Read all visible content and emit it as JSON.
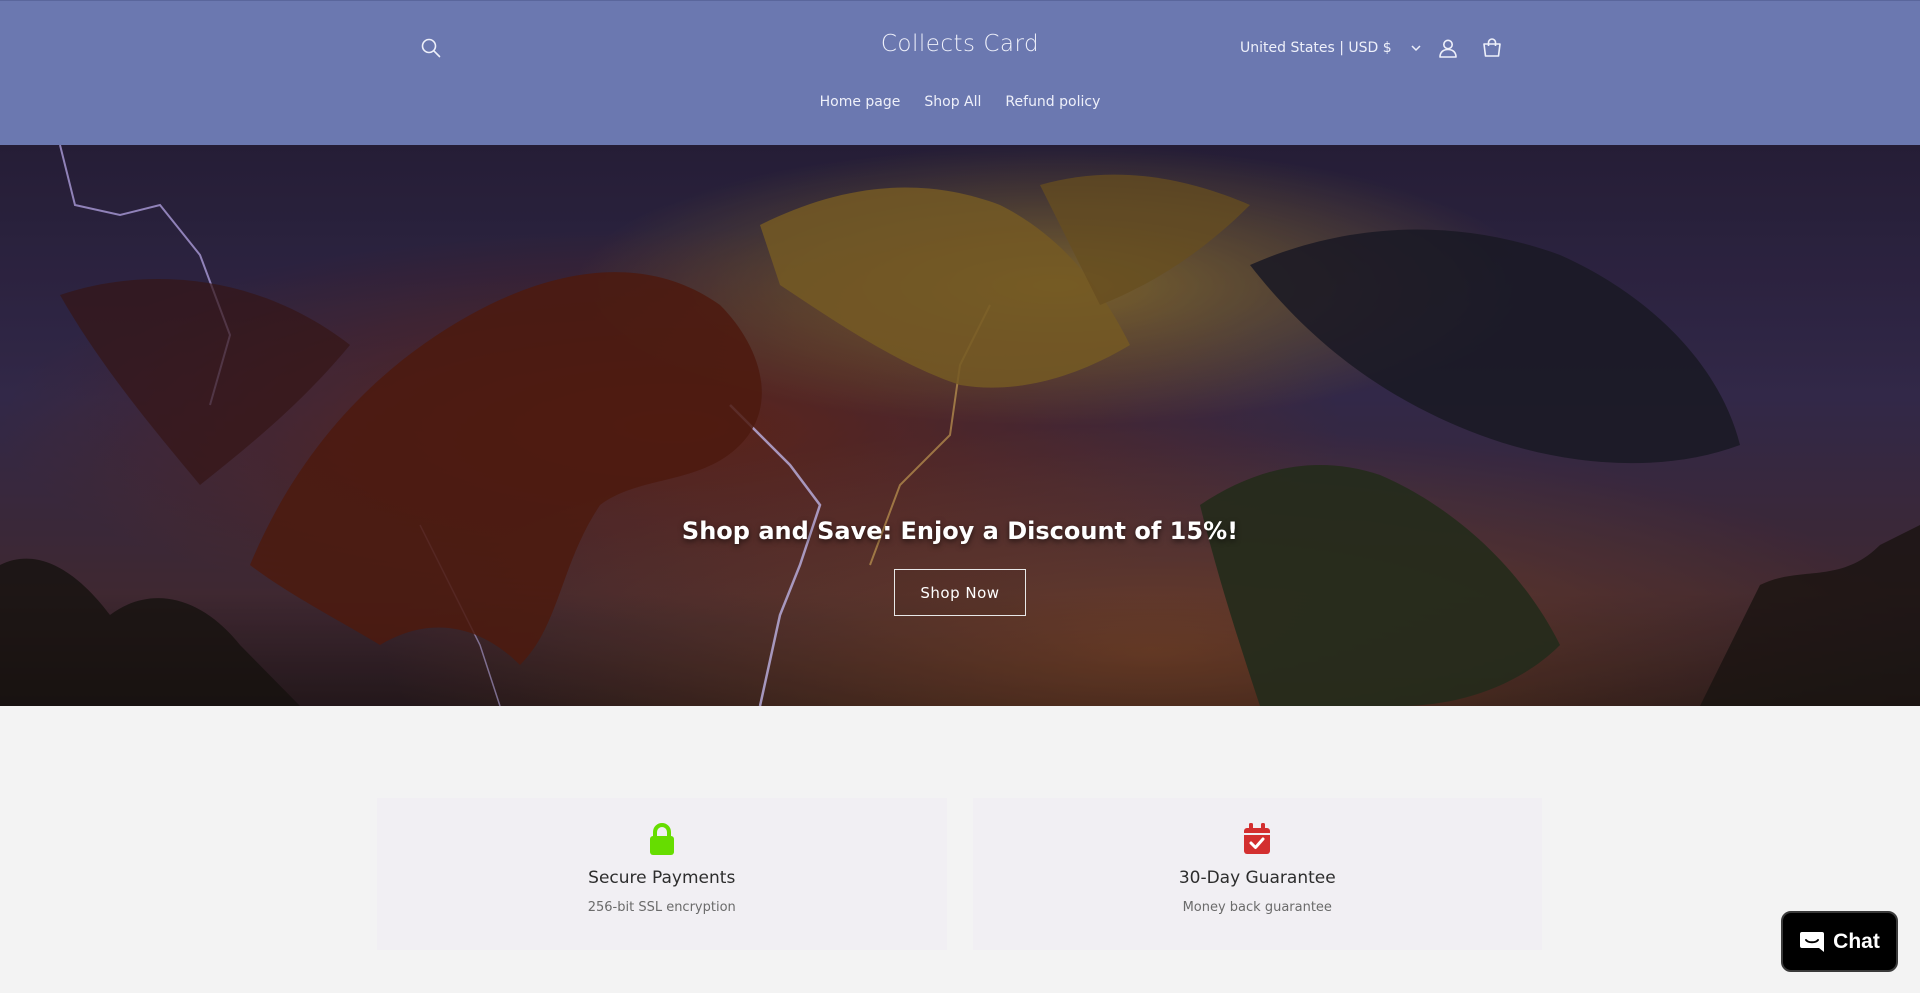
{
  "header": {
    "store_name": "Collects Card",
    "currency_selector": "United States | USD $",
    "nav": [
      "Home page",
      "Shop All",
      "Refund policy"
    ],
    "icons": [
      "search-icon",
      "account-icon",
      "cart-icon",
      "chevron-down-icon"
    ],
    "background_color": "#6b78b0"
  },
  "hero": {
    "title": "Shop and Save: Enjoy a Discount of 15%!",
    "button_label": "Shop Now"
  },
  "features": [
    {
      "icon": "lock-icon",
      "icon_color": "#66dd00",
      "title": "Secure Payments",
      "subtitle": "256-bit SSL encryption"
    },
    {
      "icon": "calendar-check-icon",
      "icon_color": "#d32f2f",
      "title": "30-Day Guarantee",
      "subtitle": "Money back guarantee"
    }
  ],
  "chat": {
    "label": "Chat",
    "icon": "chat-bubble-icon"
  }
}
